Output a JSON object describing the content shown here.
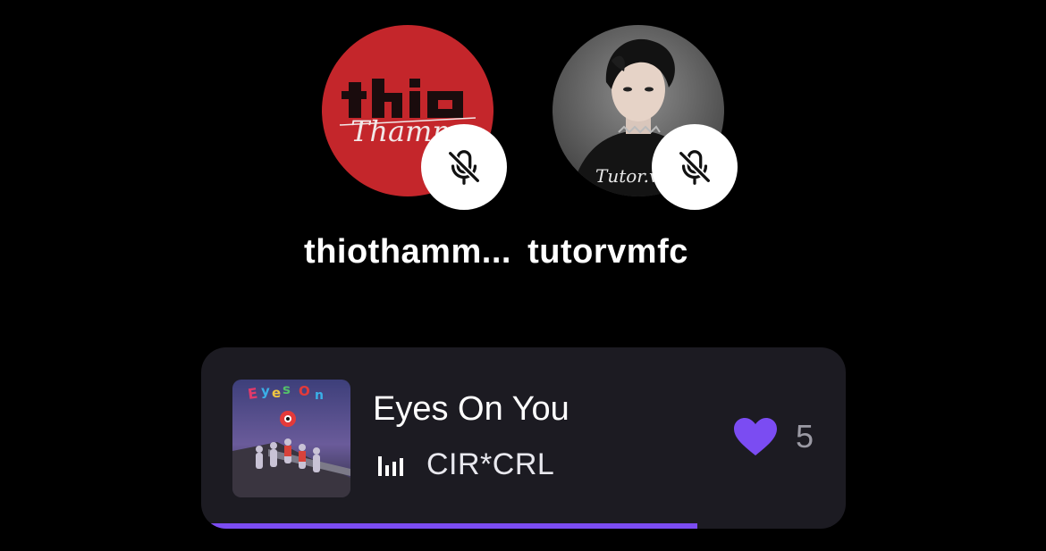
{
  "speakers": [
    {
      "name": "thiothamm...",
      "muted": true,
      "avatar": "thio-thamm-logo-avatar"
    },
    {
      "name": "tutorvmfc",
      "muted": true,
      "avatar": "person-photo-avatar"
    }
  ],
  "now_playing": {
    "title": "Eyes On You",
    "artist": "CIR*CRL",
    "likes": "5",
    "progress": 0.77,
    "accent_color": "#7b4cf2",
    "icons": {
      "playing": "equalizer-bars-icon",
      "like": "heart-icon",
      "mute": "mic-muted-icon"
    }
  }
}
